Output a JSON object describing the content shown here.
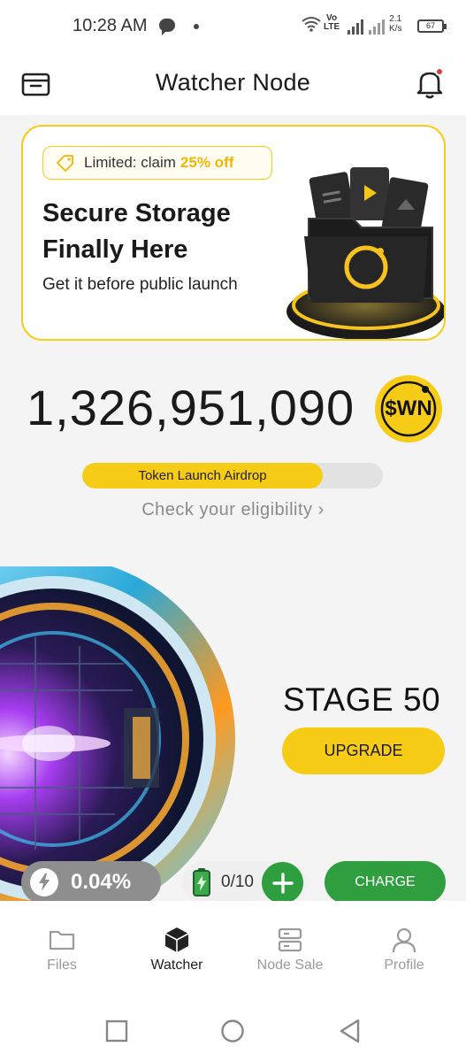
{
  "status_bar": {
    "time": "10:28 AM",
    "network": "Vo\nLTE",
    "network_speed": "2.1\nK/s",
    "battery": "67"
  },
  "header": {
    "title": "Watcher Node",
    "left_icon": "wallet-icon",
    "right_icon": "bell-icon"
  },
  "promo": {
    "tag_prefix": "Limited: claim",
    "tag_highlight": "25% off",
    "title": "Secure Storage Finally Here",
    "subtitle": "Get it before public launch"
  },
  "balance": {
    "amount": "1,326,951,090",
    "token": "$WN"
  },
  "airdrop": {
    "label": "Token Launch Airdrop",
    "progress": 0.8
  },
  "eligibility": {
    "text": "Check your eligibility ›"
  },
  "stage": {
    "label": "STAGE 50",
    "upgrade_label": "UPGRADE"
  },
  "actions": {
    "speed": "0.04%",
    "battery_count": "0/10",
    "charge_label": "CHARGE"
  },
  "tabs": [
    {
      "label": "Files",
      "icon": "folder-icon",
      "active": false
    },
    {
      "label": "Watcher",
      "icon": "cube-icon",
      "active": true
    },
    {
      "label": "Node Sale",
      "icon": "server-icon",
      "active": false
    },
    {
      "label": "Profile",
      "icon": "user-icon",
      "active": false
    }
  ],
  "colors": {
    "accent_yellow": "#f7cc16",
    "action_green": "#2e9e3f",
    "notification_red": "#e53935"
  }
}
